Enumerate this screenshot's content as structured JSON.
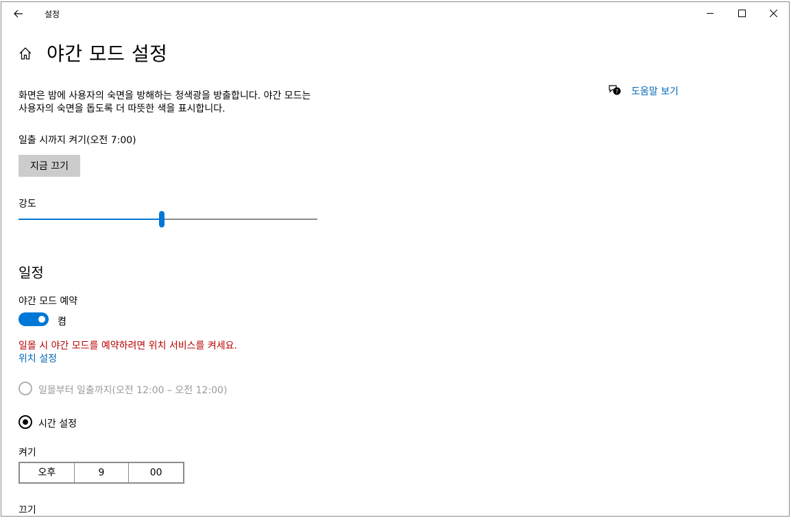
{
  "window": {
    "title": "설정"
  },
  "page": {
    "title": "야간 모드 설정"
  },
  "description": "화면은 밤에 사용자의 숙면을 방해하는 청색광을 방출합니다. 야간 모드는 사용자의 숙면을 돕도록 더 따뜻한 색을 표시합니다.",
  "status_text": "일출 시까지 켜기(오전 7:00)",
  "turn_off_now_label": "지금 끄기",
  "strength": {
    "label": "강도",
    "value_fraction": 0.48
  },
  "schedule": {
    "section_title": "일정",
    "toggle_label": "야간 모드 예약",
    "toggle_state": "켬",
    "warning": "일몰 시 야간 모드를 예약하려면 위치 서비스를 켜세요.",
    "location_link": "위치 설정",
    "option_sunset": "일몰부터 일출까지(오전 12:00 – 오전 12:00)",
    "option_custom": "시간 설정",
    "turn_on_label": "켜기",
    "turn_on_time": {
      "period": "오후",
      "hour": "9",
      "minute": "00"
    },
    "turn_off_label": "끄기"
  },
  "help": {
    "link": "도움말 보기"
  },
  "colors": {
    "accent": "#0078d7",
    "link": "#0067b8",
    "warning": "#b80000",
    "button_bg": "#cccccc"
  },
  "icons": [
    "back-arrow-icon",
    "home-icon",
    "minimize-icon",
    "maximize-icon",
    "close-icon",
    "help-chat-icon"
  ]
}
